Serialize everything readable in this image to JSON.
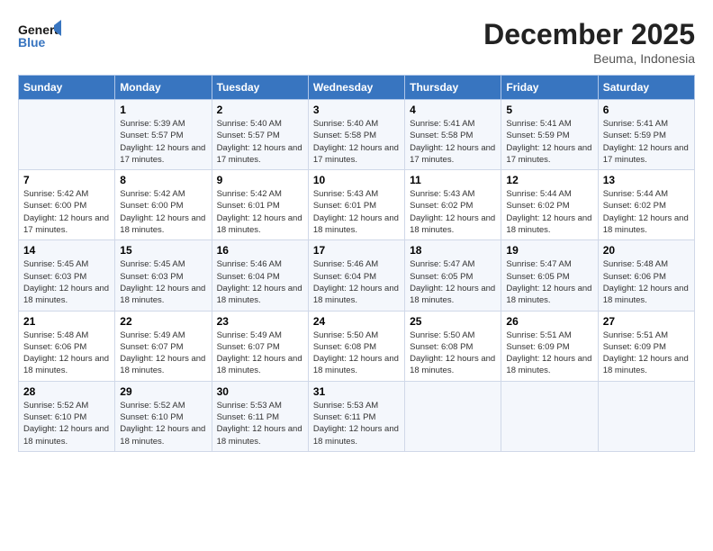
{
  "header": {
    "logo_text_general": "General",
    "logo_text_blue": "Blue",
    "month_title": "December 2025",
    "subtitle": "Beuma, Indonesia"
  },
  "days_of_week": [
    "Sunday",
    "Monday",
    "Tuesday",
    "Wednesday",
    "Thursday",
    "Friday",
    "Saturday"
  ],
  "weeks": [
    [
      {
        "day": "",
        "info": ""
      },
      {
        "day": "1",
        "info": "Sunrise: 5:39 AM\nSunset: 5:57 PM\nDaylight: 12 hours and 17 minutes."
      },
      {
        "day": "2",
        "info": "Sunrise: 5:40 AM\nSunset: 5:57 PM\nDaylight: 12 hours and 17 minutes."
      },
      {
        "day": "3",
        "info": "Sunrise: 5:40 AM\nSunset: 5:58 PM\nDaylight: 12 hours and 17 minutes."
      },
      {
        "day": "4",
        "info": "Sunrise: 5:41 AM\nSunset: 5:58 PM\nDaylight: 12 hours and 17 minutes."
      },
      {
        "day": "5",
        "info": "Sunrise: 5:41 AM\nSunset: 5:59 PM\nDaylight: 12 hours and 17 minutes."
      },
      {
        "day": "6",
        "info": "Sunrise: 5:41 AM\nSunset: 5:59 PM\nDaylight: 12 hours and 17 minutes."
      }
    ],
    [
      {
        "day": "7",
        "info": "Sunrise: 5:42 AM\nSunset: 6:00 PM\nDaylight: 12 hours and 17 minutes."
      },
      {
        "day": "8",
        "info": "Sunrise: 5:42 AM\nSunset: 6:00 PM\nDaylight: 12 hours and 18 minutes."
      },
      {
        "day": "9",
        "info": "Sunrise: 5:42 AM\nSunset: 6:01 PM\nDaylight: 12 hours and 18 minutes."
      },
      {
        "day": "10",
        "info": "Sunrise: 5:43 AM\nSunset: 6:01 PM\nDaylight: 12 hours and 18 minutes."
      },
      {
        "day": "11",
        "info": "Sunrise: 5:43 AM\nSunset: 6:02 PM\nDaylight: 12 hours and 18 minutes."
      },
      {
        "day": "12",
        "info": "Sunrise: 5:44 AM\nSunset: 6:02 PM\nDaylight: 12 hours and 18 minutes."
      },
      {
        "day": "13",
        "info": "Sunrise: 5:44 AM\nSunset: 6:02 PM\nDaylight: 12 hours and 18 minutes."
      }
    ],
    [
      {
        "day": "14",
        "info": "Sunrise: 5:45 AM\nSunset: 6:03 PM\nDaylight: 12 hours and 18 minutes."
      },
      {
        "day": "15",
        "info": "Sunrise: 5:45 AM\nSunset: 6:03 PM\nDaylight: 12 hours and 18 minutes."
      },
      {
        "day": "16",
        "info": "Sunrise: 5:46 AM\nSunset: 6:04 PM\nDaylight: 12 hours and 18 minutes."
      },
      {
        "day": "17",
        "info": "Sunrise: 5:46 AM\nSunset: 6:04 PM\nDaylight: 12 hours and 18 minutes."
      },
      {
        "day": "18",
        "info": "Sunrise: 5:47 AM\nSunset: 6:05 PM\nDaylight: 12 hours and 18 minutes."
      },
      {
        "day": "19",
        "info": "Sunrise: 5:47 AM\nSunset: 6:05 PM\nDaylight: 12 hours and 18 minutes."
      },
      {
        "day": "20",
        "info": "Sunrise: 5:48 AM\nSunset: 6:06 PM\nDaylight: 12 hours and 18 minutes."
      }
    ],
    [
      {
        "day": "21",
        "info": "Sunrise: 5:48 AM\nSunset: 6:06 PM\nDaylight: 12 hours and 18 minutes."
      },
      {
        "day": "22",
        "info": "Sunrise: 5:49 AM\nSunset: 6:07 PM\nDaylight: 12 hours and 18 minutes."
      },
      {
        "day": "23",
        "info": "Sunrise: 5:49 AM\nSunset: 6:07 PM\nDaylight: 12 hours and 18 minutes."
      },
      {
        "day": "24",
        "info": "Sunrise: 5:50 AM\nSunset: 6:08 PM\nDaylight: 12 hours and 18 minutes."
      },
      {
        "day": "25",
        "info": "Sunrise: 5:50 AM\nSunset: 6:08 PM\nDaylight: 12 hours and 18 minutes."
      },
      {
        "day": "26",
        "info": "Sunrise: 5:51 AM\nSunset: 6:09 PM\nDaylight: 12 hours and 18 minutes."
      },
      {
        "day": "27",
        "info": "Sunrise: 5:51 AM\nSunset: 6:09 PM\nDaylight: 12 hours and 18 minutes."
      }
    ],
    [
      {
        "day": "28",
        "info": "Sunrise: 5:52 AM\nSunset: 6:10 PM\nDaylight: 12 hours and 18 minutes."
      },
      {
        "day": "29",
        "info": "Sunrise: 5:52 AM\nSunset: 6:10 PM\nDaylight: 12 hours and 18 minutes."
      },
      {
        "day": "30",
        "info": "Sunrise: 5:53 AM\nSunset: 6:11 PM\nDaylight: 12 hours and 18 minutes."
      },
      {
        "day": "31",
        "info": "Sunrise: 5:53 AM\nSunset: 6:11 PM\nDaylight: 12 hours and 18 minutes."
      },
      {
        "day": "",
        "info": ""
      },
      {
        "day": "",
        "info": ""
      },
      {
        "day": "",
        "info": ""
      }
    ]
  ]
}
